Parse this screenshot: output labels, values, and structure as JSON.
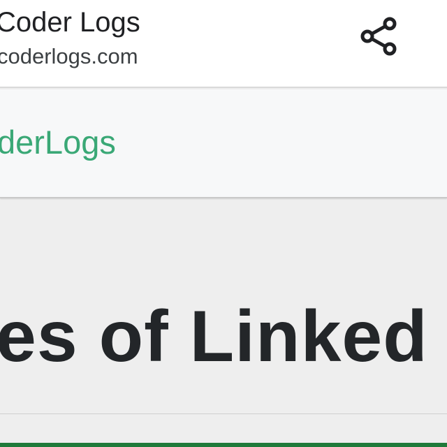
{
  "header": {
    "title": "Coder Logs",
    "url": "coderlogs.com",
    "share_icon": "share-icon"
  },
  "site_nav": {
    "brand": "derLogs",
    "brand_color": "#3aa876"
  },
  "article": {
    "headline": "es of Linked I"
  },
  "colors": {
    "header_bg": "#ffffff",
    "nav_bg": "#f7f8f9",
    "page_bg": "#eeeeee",
    "bottom_accent": "#1f7a3a"
  }
}
